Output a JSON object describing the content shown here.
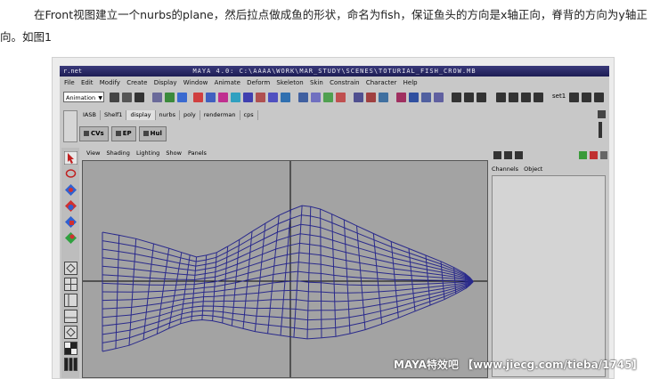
{
  "intro": {
    "line1": "在Front视图建立一个nurbs的plane，然后拉点做成鱼的形状，命名为fish，保证鱼头的方向是x轴正向，脊背的方向为y轴正",
    "line2": "向。如图1"
  },
  "window": {
    "title_left": "r.net",
    "title": "MAYA 4.0: C:\\AAAA\\WORK\\MAR_STUDY\\SCENES\\TOTURIAL_FISH_CROW.MB"
  },
  "menubar": [
    "File",
    "Edit",
    "Modify",
    "Create",
    "Display",
    "Window",
    "Animate",
    "Deform",
    "Skeleton",
    "Skin",
    "Constrain",
    "Character",
    "Help"
  ],
  "toolbar": {
    "mode": "Animation",
    "set_label": "set1"
  },
  "shelf_tabs": [
    "IASB",
    "Shelf1",
    "display",
    "nurbs",
    "poly",
    "renderman",
    "cps"
  ],
  "shelf_active": "display",
  "shelf_buttons": [
    "CVs",
    "EP",
    "Hul"
  ],
  "viewport_menu": [
    "View",
    "Shading",
    "Lighting",
    "Show",
    "Panels"
  ],
  "channel_box": {
    "tabs": [
      "Channels",
      "Object"
    ]
  },
  "watermark": "MAYA特效吧 【www.jiecg.com/tieba/1745】",
  "colors": {
    "wire": "#2a2a8c",
    "viewport_bg": "#a3a3a3",
    "title_bg": "#24245e"
  }
}
